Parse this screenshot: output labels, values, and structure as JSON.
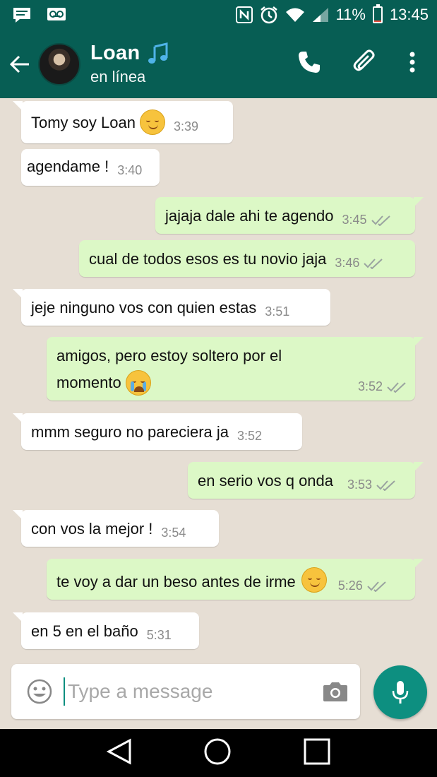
{
  "status_bar": {
    "battery_percent": "11%",
    "time": "13:45",
    "battery_level": 0.11,
    "icons": [
      "message-icon",
      "voicemail-icon",
      "nfc-icon",
      "alarm-icon",
      "wifi-icon",
      "signal-icon",
      "battery-icon"
    ]
  },
  "header": {
    "contact_name": "Loan",
    "name_emoji": "music-note-icon",
    "status": "en línea",
    "actions": [
      "phone-icon",
      "attach-icon",
      "more-icon"
    ]
  },
  "messages": [
    {
      "dir": "in",
      "text": "Tomy soy Loan",
      "emoji": "smiling-blush",
      "time": "3:39",
      "tail": true
    },
    {
      "dir": "in",
      "text": "agendame !",
      "time": "3:40",
      "tail": false
    },
    {
      "dir": "out",
      "text": "jajaja dale ahi te agendo",
      "time": "3:45",
      "tail": true
    },
    {
      "dir": "out",
      "text": "cual de todos esos es tu novio jaja",
      "time": "3:46",
      "tail": false
    },
    {
      "dir": "in",
      "text": "jeje ninguno vos con quien estas",
      "time": "3:51",
      "tail": true
    },
    {
      "dir": "out",
      "text": "amigos, pero estoy soltero por el",
      "text2": "momento",
      "emoji": "crying",
      "time": "3:52",
      "tail": true
    },
    {
      "dir": "in",
      "text": "mmm seguro no pareciera ja",
      "time": "3:52",
      "tail": true
    },
    {
      "dir": "out",
      "text": "en serio vos q onda",
      "time": "3:53",
      "tail": true
    },
    {
      "dir": "in",
      "text": "con vos la mejor !",
      "time": "3:54",
      "tail": true
    },
    {
      "dir": "out",
      "text": "te voy a dar un beso antes de irme",
      "emoji": "smiling-blush",
      "time": "5:26",
      "tail": true
    },
    {
      "dir": "in",
      "text": "en 5 en el baño",
      "time": "5:31",
      "tail": true
    }
  ],
  "input": {
    "placeholder": "Type a message",
    "value": ""
  },
  "colors": {
    "header": "#075e54",
    "accent": "#0d8f80",
    "outgoing_bubble": "#dcf8c6",
    "incoming_bubble": "#ffffff",
    "chat_background": "#e6ded4"
  }
}
